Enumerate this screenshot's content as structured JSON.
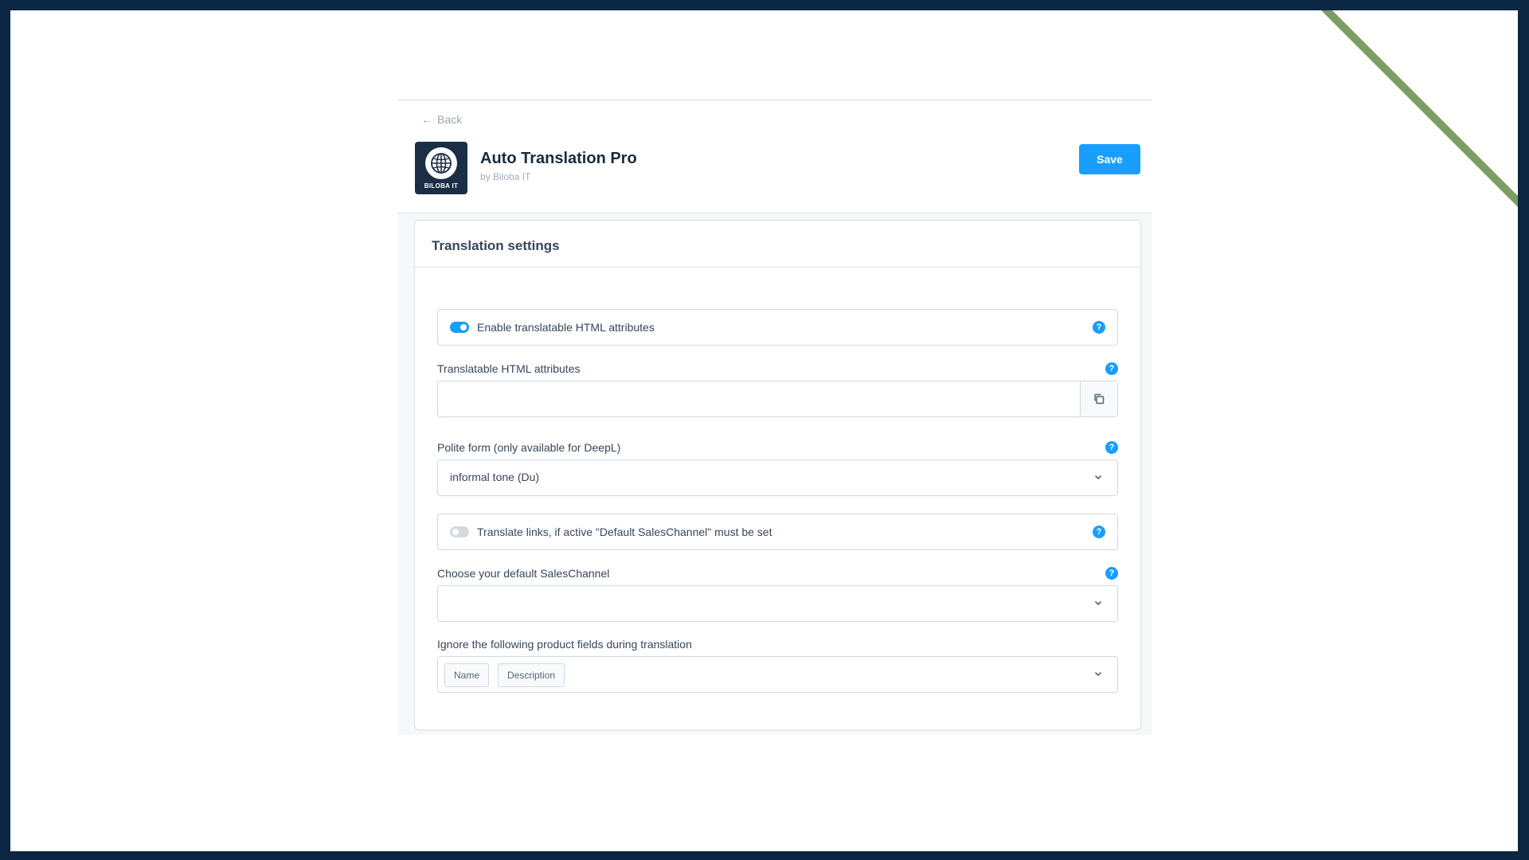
{
  "colors": {
    "accent": "#189eff",
    "frame_border": "#0c2743",
    "corner_accent": "#7b9e63",
    "logo_bg": "#1c2e45",
    "text_primary": "#1b2a3c"
  },
  "header": {
    "back_label": "Back",
    "back_icon": "arrow-left-icon",
    "app_title": "Auto Translation Pro",
    "app_vendor": "by Biloba IT",
    "logo_text": "BILOBA IT",
    "logo_icon": "globe-icon",
    "save_label": "Save"
  },
  "card": {
    "title": "Translation settings",
    "enable_attributes": {
      "label": "Enable translatable HTML attributes",
      "checked": true
    },
    "translatable_attributes": {
      "label": "Translatable HTML attributes",
      "value": "",
      "copy_icon": "copy-icon"
    },
    "polite_form": {
      "label": "Polite form (only available for DeepL)",
      "value": "informal tone (Du)"
    },
    "translate_links": {
      "label": "Translate links, if active \"Default SalesChannel\" must be set",
      "checked": false
    },
    "default_saleschannel": {
      "label": "Choose your default SalesChannel",
      "value": ""
    },
    "ignore_fields": {
      "label": "Ignore the following product fields during translation",
      "tags": [
        "Name",
        "Description"
      ]
    },
    "help_icon_glyph": "?"
  }
}
